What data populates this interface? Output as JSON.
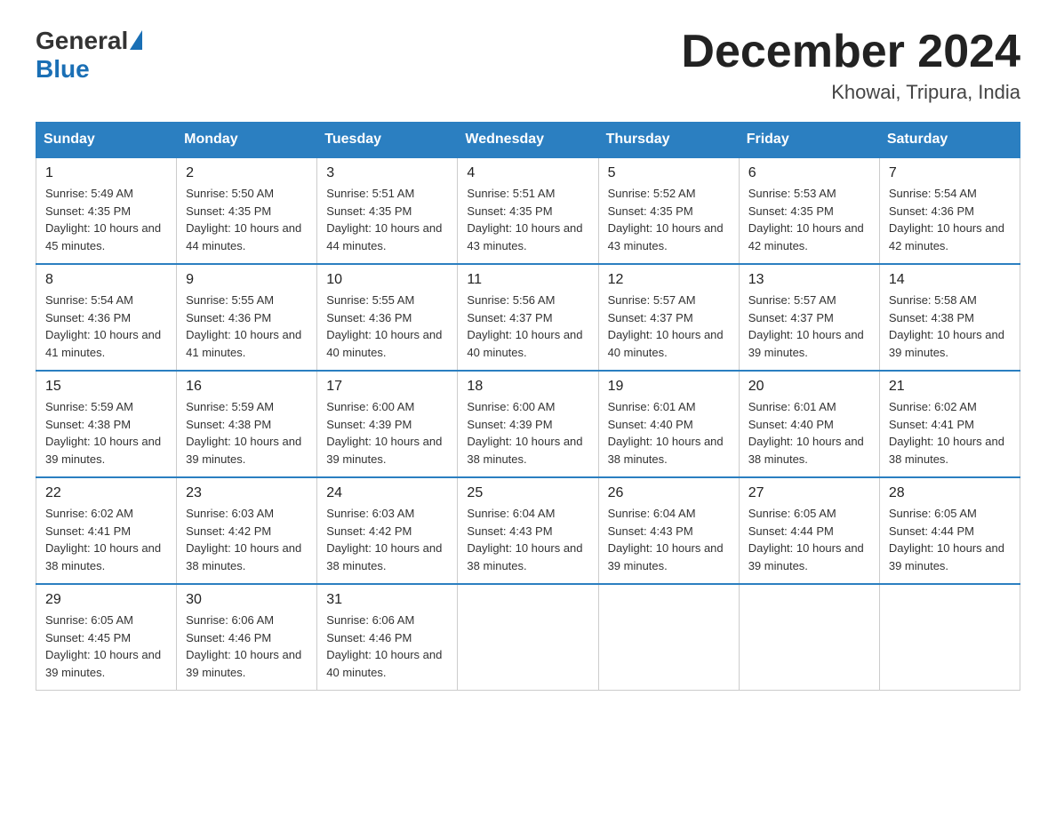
{
  "logo": {
    "general": "General",
    "blue": "Blue"
  },
  "header": {
    "month_year": "December 2024",
    "location": "Khowai, Tripura, India"
  },
  "days_of_week": [
    "Sunday",
    "Monday",
    "Tuesday",
    "Wednesday",
    "Thursday",
    "Friday",
    "Saturday"
  ],
  "weeks": [
    [
      {
        "day": "1",
        "sunrise": "5:49 AM",
        "sunset": "4:35 PM",
        "daylight": "10 hours and 45 minutes."
      },
      {
        "day": "2",
        "sunrise": "5:50 AM",
        "sunset": "4:35 PM",
        "daylight": "10 hours and 44 minutes."
      },
      {
        "day": "3",
        "sunrise": "5:51 AM",
        "sunset": "4:35 PM",
        "daylight": "10 hours and 44 minutes."
      },
      {
        "day": "4",
        "sunrise": "5:51 AM",
        "sunset": "4:35 PM",
        "daylight": "10 hours and 43 minutes."
      },
      {
        "day": "5",
        "sunrise": "5:52 AM",
        "sunset": "4:35 PM",
        "daylight": "10 hours and 43 minutes."
      },
      {
        "day": "6",
        "sunrise": "5:53 AM",
        "sunset": "4:35 PM",
        "daylight": "10 hours and 42 minutes."
      },
      {
        "day": "7",
        "sunrise": "5:54 AM",
        "sunset": "4:36 PM",
        "daylight": "10 hours and 42 minutes."
      }
    ],
    [
      {
        "day": "8",
        "sunrise": "5:54 AM",
        "sunset": "4:36 PM",
        "daylight": "10 hours and 41 minutes."
      },
      {
        "day": "9",
        "sunrise": "5:55 AM",
        "sunset": "4:36 PM",
        "daylight": "10 hours and 41 minutes."
      },
      {
        "day": "10",
        "sunrise": "5:55 AM",
        "sunset": "4:36 PM",
        "daylight": "10 hours and 40 minutes."
      },
      {
        "day": "11",
        "sunrise": "5:56 AM",
        "sunset": "4:37 PM",
        "daylight": "10 hours and 40 minutes."
      },
      {
        "day": "12",
        "sunrise": "5:57 AM",
        "sunset": "4:37 PM",
        "daylight": "10 hours and 40 minutes."
      },
      {
        "day": "13",
        "sunrise": "5:57 AM",
        "sunset": "4:37 PM",
        "daylight": "10 hours and 39 minutes."
      },
      {
        "day": "14",
        "sunrise": "5:58 AM",
        "sunset": "4:38 PM",
        "daylight": "10 hours and 39 minutes."
      }
    ],
    [
      {
        "day": "15",
        "sunrise": "5:59 AM",
        "sunset": "4:38 PM",
        "daylight": "10 hours and 39 minutes."
      },
      {
        "day": "16",
        "sunrise": "5:59 AM",
        "sunset": "4:38 PM",
        "daylight": "10 hours and 39 minutes."
      },
      {
        "day": "17",
        "sunrise": "6:00 AM",
        "sunset": "4:39 PM",
        "daylight": "10 hours and 39 minutes."
      },
      {
        "day": "18",
        "sunrise": "6:00 AM",
        "sunset": "4:39 PM",
        "daylight": "10 hours and 38 minutes."
      },
      {
        "day": "19",
        "sunrise": "6:01 AM",
        "sunset": "4:40 PM",
        "daylight": "10 hours and 38 minutes."
      },
      {
        "day": "20",
        "sunrise": "6:01 AM",
        "sunset": "4:40 PM",
        "daylight": "10 hours and 38 minutes."
      },
      {
        "day": "21",
        "sunrise": "6:02 AM",
        "sunset": "4:41 PM",
        "daylight": "10 hours and 38 minutes."
      }
    ],
    [
      {
        "day": "22",
        "sunrise": "6:02 AM",
        "sunset": "4:41 PM",
        "daylight": "10 hours and 38 minutes."
      },
      {
        "day": "23",
        "sunrise": "6:03 AM",
        "sunset": "4:42 PM",
        "daylight": "10 hours and 38 minutes."
      },
      {
        "day": "24",
        "sunrise": "6:03 AM",
        "sunset": "4:42 PM",
        "daylight": "10 hours and 38 minutes."
      },
      {
        "day": "25",
        "sunrise": "6:04 AM",
        "sunset": "4:43 PM",
        "daylight": "10 hours and 38 minutes."
      },
      {
        "day": "26",
        "sunrise": "6:04 AM",
        "sunset": "4:43 PM",
        "daylight": "10 hours and 39 minutes."
      },
      {
        "day": "27",
        "sunrise": "6:05 AM",
        "sunset": "4:44 PM",
        "daylight": "10 hours and 39 minutes."
      },
      {
        "day": "28",
        "sunrise": "6:05 AM",
        "sunset": "4:44 PM",
        "daylight": "10 hours and 39 minutes."
      }
    ],
    [
      {
        "day": "29",
        "sunrise": "6:05 AM",
        "sunset": "4:45 PM",
        "daylight": "10 hours and 39 minutes."
      },
      {
        "day": "30",
        "sunrise": "6:06 AM",
        "sunset": "4:46 PM",
        "daylight": "10 hours and 39 minutes."
      },
      {
        "day": "31",
        "sunrise": "6:06 AM",
        "sunset": "4:46 PM",
        "daylight": "10 hours and 40 minutes."
      },
      null,
      null,
      null,
      null
    ]
  ]
}
